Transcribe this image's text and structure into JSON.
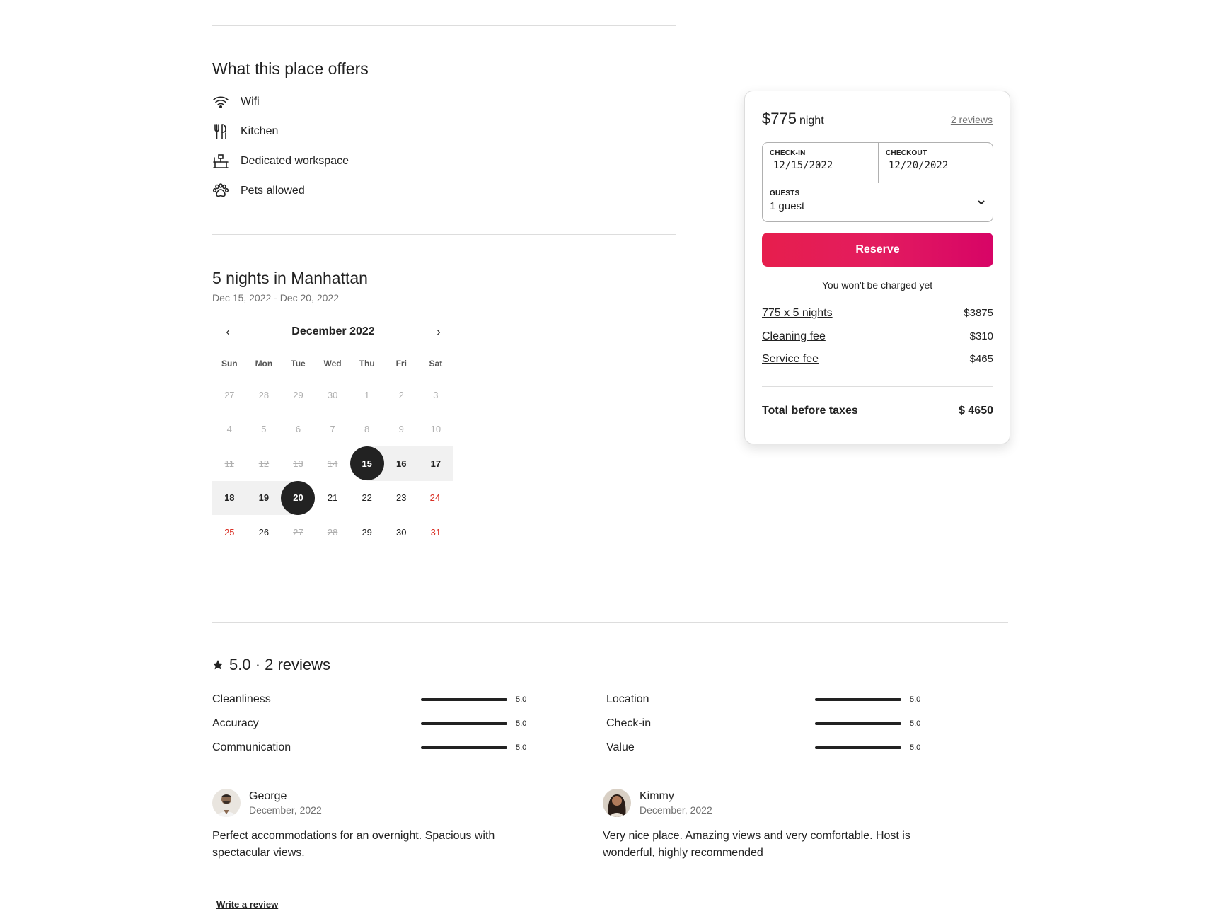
{
  "amenities": {
    "title": "What this place offers",
    "items": [
      {
        "label": "Wifi",
        "icon": "wifi-icon"
      },
      {
        "label": "Kitchen",
        "icon": "kitchen-icon"
      },
      {
        "label": "Dedicated workspace",
        "icon": "workspace-icon"
      },
      {
        "label": "Pets allowed",
        "icon": "paw-icon"
      }
    ]
  },
  "stay": {
    "title": "5 nights in Manhattan",
    "dates": "Dec 15, 2022 - Dec 20, 2022"
  },
  "calendar": {
    "month": "December 2022",
    "prev": "‹",
    "next": "›",
    "weekdays": [
      "Sun",
      "Mon",
      "Tue",
      "Wed",
      "Thu",
      "Fri",
      "Sat"
    ],
    "weeks": [
      [
        {
          "d": "27",
          "s": "past"
        },
        {
          "d": "28",
          "s": "past"
        },
        {
          "d": "29",
          "s": "past"
        },
        {
          "d": "30",
          "s": "past"
        },
        {
          "d": "1",
          "s": "past"
        },
        {
          "d": "2",
          "s": "past"
        },
        {
          "d": "3",
          "s": "past"
        }
      ],
      [
        {
          "d": "4",
          "s": "past"
        },
        {
          "d": "5",
          "s": "past"
        },
        {
          "d": "6",
          "s": "past"
        },
        {
          "d": "7",
          "s": "past"
        },
        {
          "d": "8",
          "s": "past"
        },
        {
          "d": "9",
          "s": "past"
        },
        {
          "d": "10",
          "s": "past"
        }
      ],
      [
        {
          "d": "11",
          "s": "past"
        },
        {
          "d": "12",
          "s": "past"
        },
        {
          "d": "13",
          "s": "past"
        },
        {
          "d": "14",
          "s": "past"
        },
        {
          "d": "15",
          "s": "sel-start"
        },
        {
          "d": "16",
          "s": "range"
        },
        {
          "d": "17",
          "s": "range"
        }
      ],
      [
        {
          "d": "18",
          "s": "range"
        },
        {
          "d": "19",
          "s": "range"
        },
        {
          "d": "20",
          "s": "sel-end"
        },
        {
          "d": "21",
          "s": "avail"
        },
        {
          "d": "22",
          "s": "avail"
        },
        {
          "d": "23",
          "s": "avail"
        },
        {
          "d": "24",
          "s": "weekend-cursor"
        }
      ],
      [
        {
          "d": "25",
          "s": "weekend"
        },
        {
          "d": "26",
          "s": "avail"
        },
        {
          "d": "27",
          "s": "past"
        },
        {
          "d": "28",
          "s": "past"
        },
        {
          "d": "29",
          "s": "avail"
        },
        {
          "d": "30",
          "s": "avail"
        },
        {
          "d": "31",
          "s": "weekend"
        }
      ]
    ]
  },
  "booking": {
    "price": "$775",
    "price_unit": "night",
    "reviews_link": "2 reviews",
    "checkin_label": "CHECK-IN",
    "checkin_value": "12/15/2022",
    "checkout_label": "CHECKOUT",
    "checkout_value": "12/20/2022",
    "guests_label": "GUESTS",
    "guests_value": "1 guest",
    "reserve_label": "Reserve",
    "no_charge": "You won't be charged yet",
    "fees": [
      {
        "label": "775 x 5 nights",
        "value": "$3875"
      },
      {
        "label": "Cleaning fee",
        "value": "$310"
      },
      {
        "label": "Service fee",
        "value": "$465"
      }
    ],
    "total_label": "Total before taxes",
    "total_value": "$ 4650",
    "accent_color": "#e31c5f"
  },
  "reviews": {
    "title": "5.0 · 2 reviews",
    "ratings_left": [
      {
        "label": "Cleanliness",
        "value": "5.0"
      },
      {
        "label": "Accuracy",
        "value": "5.0"
      },
      {
        "label": "Communication",
        "value": "5.0"
      }
    ],
    "ratings_right": [
      {
        "label": "Location",
        "value": "5.0"
      },
      {
        "label": "Check-in",
        "value": "5.0"
      },
      {
        "label": "Value",
        "value": "5.0"
      }
    ],
    "items": [
      {
        "name": "George",
        "date": "December, 2022",
        "text": "Perfect accommodations for an overnight. Spacious with spectacular views."
      },
      {
        "name": "Kimmy",
        "date": "December, 2022",
        "text": "Very nice place. Amazing views and very comfortable. Host is wonderful, highly recommended"
      }
    ],
    "write_review": "Write a review"
  }
}
